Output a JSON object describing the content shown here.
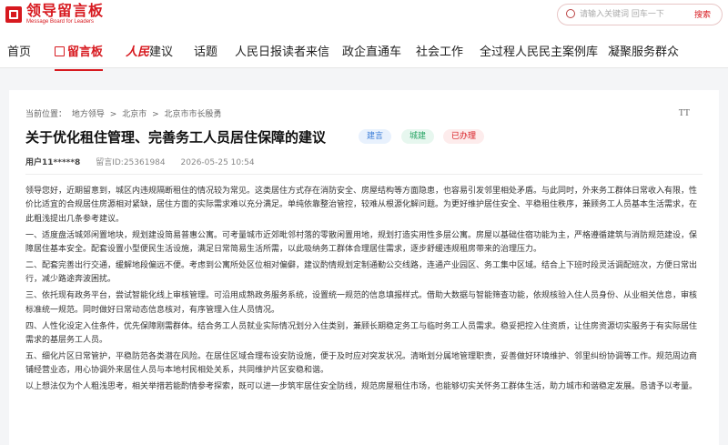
{
  "header": {
    "logo_title": "领导留言板",
    "logo_sub": "Message Board for Leaders",
    "search_placeholder": "请输入关键词 回车一下",
    "search_button": "搜索"
  },
  "nav": {
    "items": [
      "首页",
      "留言板",
      "建议",
      "话题",
      "人民日报读者来信",
      "政企直通车",
      "社会工作",
      "全过程人民民主案例库",
      "凝聚服务群众"
    ],
    "brand_renmin": "人民",
    "active_index": 1
  },
  "breadcrumb": [
    "当前位置：",
    "地方领导",
    ">",
    "北京市",
    ">",
    "北京市市长殷勇"
  ],
  "font_size_icon": "TT",
  "article": {
    "title": "关于优化租住管理、完善务工人员居住保障的建议",
    "tags": [
      {
        "label": "建言",
        "color": "#3d7ed8"
      },
      {
        "label": "城建",
        "color": "#2aa566"
      },
      {
        "label": "已办理",
        "color": "#d7191f"
      }
    ],
    "user": "用户11*****8",
    "message_id": "留言ID:25361984",
    "datetime": "2026-05-25 10:54",
    "paragraphs": [
      "领导您好，近期留意到，城区内违规隔断租住的情况较为常见。这类居住方式存在消防安全、房屋结构等方面隐患，也容易引发邻里相处矛盾。与此同时，外来务工群体日常收入有限，性价比适宜的合规居住房源相对紧缺，居住方面的实际需求难以充分满足。单纯依靠整治管控，较难从根源化解问题。为更好维护居住安全、平稳租住秩序，兼顾务工人员基本生活需求，在此粗浅提出几条参考建议。",
      "一、适度盘活城郊闲置地块，规划建设简易普惠公寓。可考量城市近郊毗邻村落的零散闲置用地，规划打造实用性多层公寓。房屋以基础住宿功能为主，严格遵循建筑与消防规范建设，保障居住基本安全。配套设置小型便民生活设施，满足日常简易生活所需，以此吸纳务工群体合理居住需求，逐步舒缓违规租房带来的治理压力。",
      "二、配套完善出行交通，缓解地段偏远不便。考虑到公寓所处区位相对偏僻，建议酌情规划定制通勤公交线路，连通产业园区、务工集中区域。结合上下班时段灵活调配班次，方便日常出行，减少路途奔波困扰。",
      "三、依托现有政务平台，尝试智能化线上审核管理。可沿用成熟政务服务系统，设置统一规范的信息填报样式。借助大数据与智能筛查功能，依规核验入住人员身份、从业相关信息，审核标准统一规范。同时做好日常动态信息核对，有序管理入住人员情况。",
      "四、人性化设定入住条件，优先保障刚需群体。结合务工人员就业实际情况划分入住类别，兼顾长期稳定务工与临时务工人员需求。稳妥把控入住资质，让住房资源切实服务于有实际居住需求的基层务工人员。",
      "五、细化片区日常管护，平稳防范各类潜在风险。在居住区域合理布设安防设施，便于及时应对突发状况。清晰划分属地管理职责，妥善做好环境维护、邻里纠纷协调等工作。规范周边商铺经营业态，用心协调外来居住人员与本地村民相处关系，共同维护片区安稳和谐。",
      "以上想法仅为个人粗浅思考，相关举措若能酌情参考探索，既可以进一步筑牢居住安全防线，规范房屋租住市场，也能够切实关怀务工群体生活，助力城市和谐稳定发展。恳请予以考量。"
    ]
  }
}
